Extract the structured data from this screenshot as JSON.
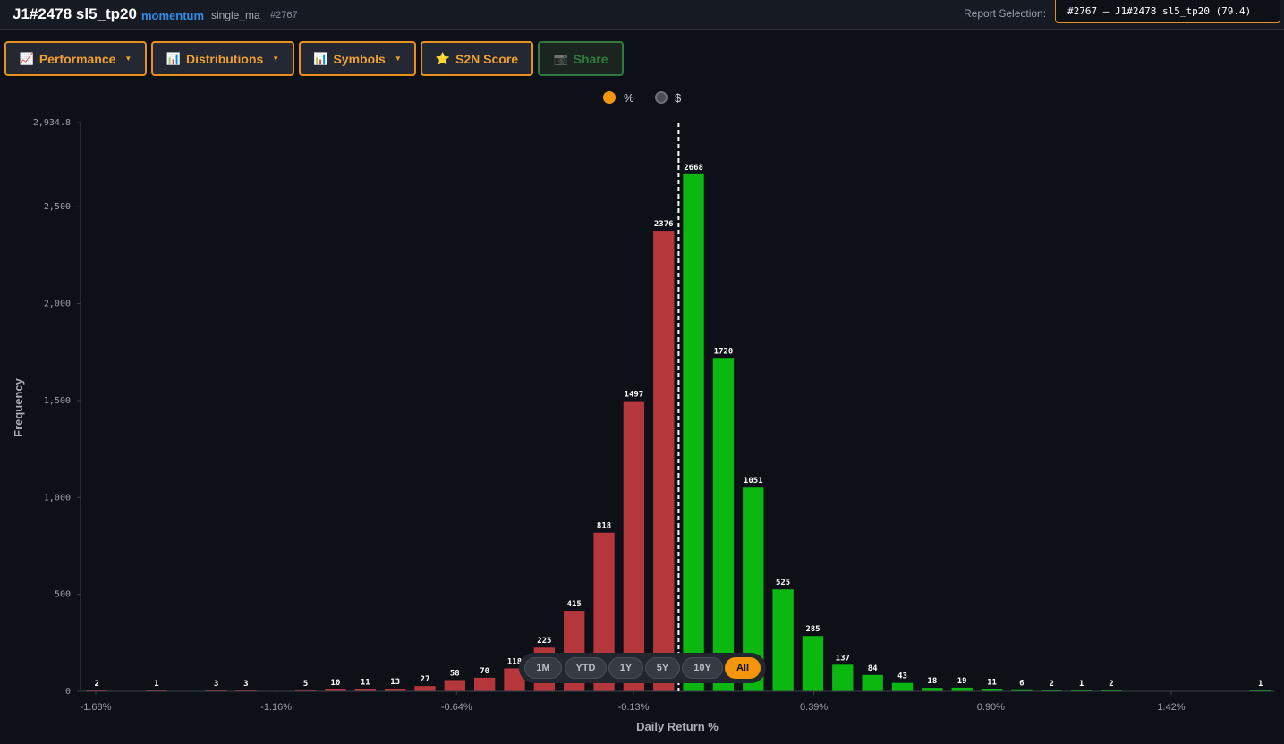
{
  "header": {
    "title": "J1#2478 sl5_tp20",
    "strategy_tag": "momentum",
    "type_tag": "single_ma",
    "id_tag": "#2767",
    "report_label": "Report Selection:",
    "report_value": "#2767 – J1#2478 sl5_tp20 (79.4)"
  },
  "toolbar": {
    "performance": {
      "label": "Performance",
      "icon": "chart-increasing-icon"
    },
    "distributions": {
      "label": "Distributions",
      "icon": "bar-chart-icon"
    },
    "symbols": {
      "label": "Symbols",
      "icon": "bar-chart-icon"
    },
    "s2n": {
      "label": "S2N Score",
      "icon": "star-icon"
    },
    "share": {
      "label": "Share",
      "icon": "camera-icon"
    }
  },
  "unit_toggle": {
    "percent_label": "%",
    "dollar_label": "$",
    "selected": "%"
  },
  "range_selector": {
    "options": [
      "1M",
      "YTD",
      "1Y",
      "5Y",
      "10Y",
      "All"
    ],
    "selected": "All"
  },
  "colors": {
    "negative": "#b5363b",
    "positive": "#0ab80f",
    "accent": "#f3950d",
    "background": "#0d1017"
  },
  "chart_data": {
    "type": "bar",
    "title": "",
    "xlabel": "Daily Return %",
    "ylabel": "Frequency",
    "ylim": [
      0,
      2934.8
    ],
    "yticks": [
      0,
      500,
      1000,
      1500,
      2000,
      2500,
      2934.8
    ],
    "ytick_labels": [
      "0",
      "500",
      "1,000",
      "1,500",
      "2,000",
      "2,500",
      "2,934.8"
    ],
    "xticks": [
      -1.68,
      -1.16,
      -0.64,
      -0.13,
      0.39,
      0.9,
      1.42
    ],
    "xtick_labels": [
      "-1.68%",
      "-1.16%",
      "-0.64%",
      "-0.13%",
      "0.39%",
      "0.90%",
      "1.42%"
    ],
    "zero_line": 0.0,
    "bin_width": 0.086,
    "bins": [
      {
        "center": -1.677,
        "count": 2
      },
      {
        "center": -1.591,
        "count": 0
      },
      {
        "center": -1.505,
        "count": 1
      },
      {
        "center": -1.419,
        "count": 0
      },
      {
        "center": -1.333,
        "count": 3
      },
      {
        "center": -1.247,
        "count": 3
      },
      {
        "center": -1.161,
        "count": 0
      },
      {
        "center": -1.075,
        "count": 5
      },
      {
        "center": -0.989,
        "count": 10
      },
      {
        "center": -0.903,
        "count": 11
      },
      {
        "center": -0.817,
        "count": 13
      },
      {
        "center": -0.731,
        "count": 27
      },
      {
        "center": -0.645,
        "count": 58
      },
      {
        "center": -0.559,
        "count": 70
      },
      {
        "center": -0.473,
        "count": 118
      },
      {
        "center": -0.387,
        "count": 225
      },
      {
        "center": -0.301,
        "count": 415
      },
      {
        "center": -0.215,
        "count": 818
      },
      {
        "center": -0.129,
        "count": 1497
      },
      {
        "center": -0.043,
        "count": 2376
      },
      {
        "center": 0.043,
        "count": 2668
      },
      {
        "center": 0.129,
        "count": 1720
      },
      {
        "center": 0.215,
        "count": 1051
      },
      {
        "center": 0.301,
        "count": 525
      },
      {
        "center": 0.387,
        "count": 285
      },
      {
        "center": 0.473,
        "count": 137
      },
      {
        "center": 0.559,
        "count": 84
      },
      {
        "center": 0.645,
        "count": 43
      },
      {
        "center": 0.731,
        "count": 18
      },
      {
        "center": 0.817,
        "count": 19
      },
      {
        "center": 0.903,
        "count": 11
      },
      {
        "center": 0.989,
        "count": 6
      },
      {
        "center": 1.075,
        "count": 2
      },
      {
        "center": 1.161,
        "count": 1
      },
      {
        "center": 1.247,
        "count": 2
      },
      {
        "center": 1.333,
        "count": 0
      },
      {
        "center": 1.419,
        "count": 0
      },
      {
        "center": 1.505,
        "count": 0
      },
      {
        "center": 1.591,
        "count": 0
      },
      {
        "center": 1.677,
        "count": 1
      }
    ]
  }
}
